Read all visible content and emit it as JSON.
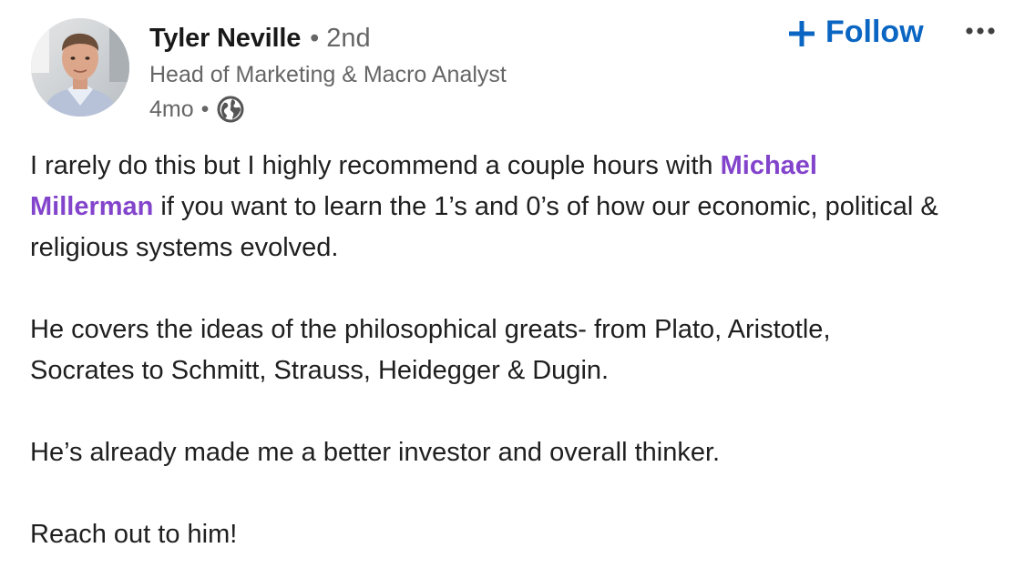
{
  "author": {
    "name": "Tyler Neville",
    "degree": "2nd",
    "headline": "Head of Marketing & Macro Analyst",
    "time_ago": "4mo",
    "visibility_icon": "globe-icon",
    "avatar_icon": "profile-photo"
  },
  "actions": {
    "follow_label": "Follow",
    "follow_icon": "plus-icon",
    "more_icon": "ellipsis-icon"
  },
  "separator": "•",
  "post": {
    "line1_before": "I rarely do this but I highly recommend a couple hours with ",
    "mention": "Michael Millerman",
    "line1_after": " if you want to learn the 1’s and 0’s of how our economic, political & religious systems evolved.",
    "paragraph2": "He covers the ideas of the philosophical greats- from Plato, Aristotle, Socrates to Schmitt, Strauss, Heidegger & Dugin.",
    "paragraph3": "He’s already made me a better investor and overall thinker.",
    "paragraph4": "Reach out to him!"
  },
  "colors": {
    "accent_blue": "#0a66c2",
    "mention_purple": "#8344cc",
    "secondary_text": "#666666",
    "primary_text": "#1f1f1f"
  }
}
